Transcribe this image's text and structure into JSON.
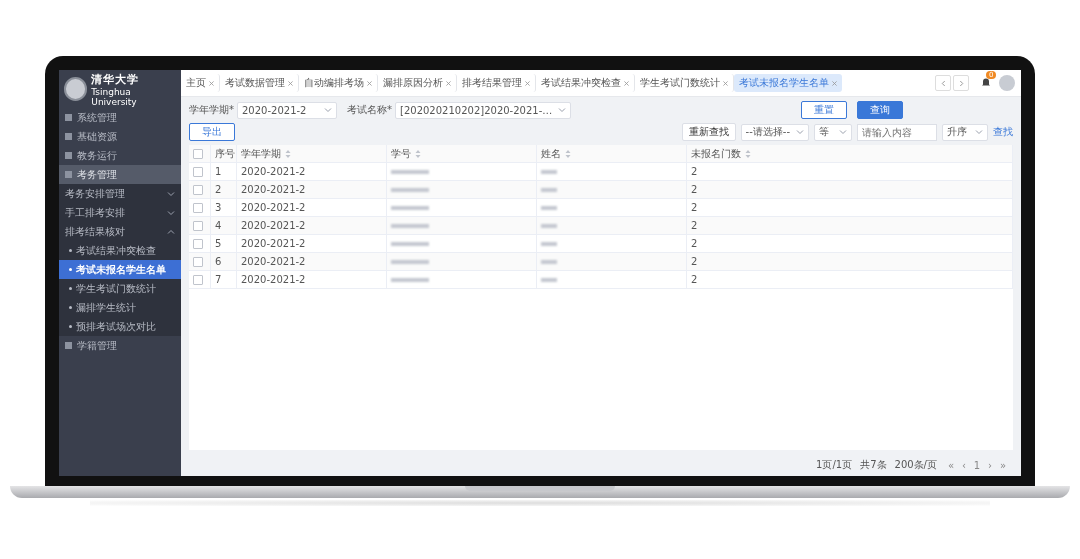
{
  "logo": {
    "name": "清华大学",
    "subtitle": "Tsinghua University"
  },
  "sidebar": {
    "items": [
      {
        "label": "系统管理",
        "kind": "top",
        "selected": false
      },
      {
        "label": "基础资源",
        "kind": "top",
        "selected": false
      },
      {
        "label": "教务运行",
        "kind": "top",
        "selected": false
      },
      {
        "label": "考务管理",
        "kind": "top",
        "selected": true
      },
      {
        "label": "考务安排管理",
        "kind": "group",
        "expanded": false,
        "selected": false
      },
      {
        "label": "手工排考安排",
        "kind": "group",
        "expanded": false,
        "selected": false
      },
      {
        "label": "排考结果核对",
        "kind": "group",
        "expanded": true,
        "selected": false,
        "children": [
          {
            "label": "考试结果冲突检查",
            "selected": false
          },
          {
            "label": "考试未报名学生名单",
            "selected": true
          },
          {
            "label": "学生考试门数统计",
            "selected": false
          },
          {
            "label": "漏排学生统计",
            "selected": false
          },
          {
            "label": "预排考试场次对比",
            "selected": false
          }
        ]
      },
      {
        "label": "学籍管理",
        "kind": "top",
        "selected": false
      }
    ]
  },
  "tabs": [
    {
      "label": "主页",
      "selected": false
    },
    {
      "label": "考试数据管理",
      "selected": false
    },
    {
      "label": "自动编排考场",
      "selected": false
    },
    {
      "label": "漏排原因分析",
      "selected": false
    },
    {
      "label": "排考结果管理",
      "selected": false
    },
    {
      "label": "考试结果冲突检查",
      "selected": false
    },
    {
      "label": "学生考试门数统计",
      "selected": false
    },
    {
      "label": "考试未报名学生名单",
      "selected": true
    }
  ],
  "notifications": {
    "badge": "0"
  },
  "filters": [
    {
      "label": "学年学期*",
      "value": "2020-2021-2"
    },
    {
      "label": "考试名称*",
      "value": "[202020210202]2020-2021-…"
    }
  ],
  "buttons": {
    "reset": "重置",
    "query": "查询",
    "export": "导出"
  },
  "toolbar": {
    "refind": "重新查找",
    "field": "--请选择--",
    "operator": "等",
    "search_placeholder": "请输入内容",
    "order": "升序",
    "find": "查找"
  },
  "table": {
    "select_all_checked": false,
    "columns": [
      "序号",
      "学年学期",
      "学号",
      "姓名",
      "未报名门数"
    ],
    "rows": [
      {
        "no": "1",
        "term": "2020-2021-2",
        "count": "2",
        "checked": false
      },
      {
        "no": "2",
        "term": "2020-2021-2",
        "count": "2",
        "checked": false
      },
      {
        "no": "3",
        "term": "2020-2021-2",
        "count": "2",
        "checked": false
      },
      {
        "no": "4",
        "term": "2020-2021-2",
        "count": "2",
        "checked": false
      },
      {
        "no": "5",
        "term": "2020-2021-2",
        "count": "2",
        "checked": false
      },
      {
        "no": "6",
        "term": "2020-2021-2",
        "count": "2",
        "checked": false
      },
      {
        "no": "7",
        "term": "2020-2021-2",
        "count": "2",
        "checked": false
      }
    ]
  },
  "pagination": {
    "pages": "1页/1页",
    "total": "共7条",
    "page_size": "200条/页",
    "controls": [
      "«",
      "‹",
      "1",
      "›",
      "»"
    ]
  }
}
